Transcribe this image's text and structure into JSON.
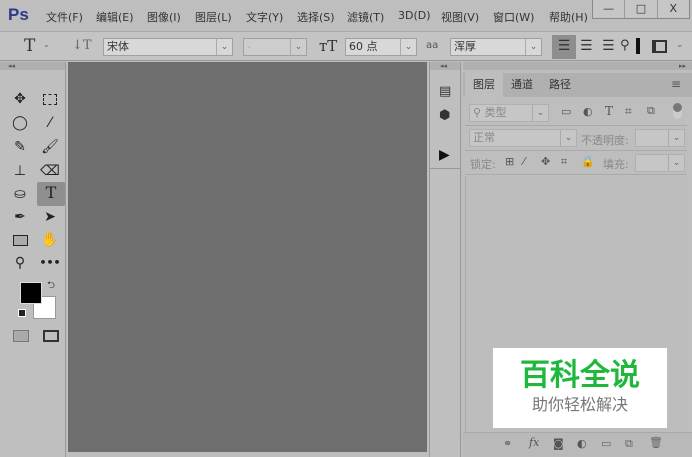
{
  "app": {
    "logo": "Ps"
  },
  "menu": [
    "文件(F)",
    "编辑(E)",
    "图像(I)",
    "图层(L)",
    "文字(Y)",
    "选择(S)",
    "滤镜(T)",
    "3D(D)",
    "视图(V)",
    "窗口(W)",
    "帮助(H)"
  ],
  "window_buttons": {
    "minimize": "—",
    "maximize": "□",
    "close": "X"
  },
  "options": {
    "tool_glyph": "T",
    "font_family": "宋体",
    "font_style": "-",
    "font_size": "60 点",
    "antialias_label": "aa",
    "antialias": "浑厚"
  },
  "tools": {
    "panel_collapse": "◂◂",
    "text_tool": "T",
    "more": "•••"
  },
  "colors": {
    "foreground": "#000000",
    "background": "#ffffff",
    "accent": "#2b3a8a",
    "watermark_green": "#1fb83c"
  },
  "mini_panel": {
    "collapse": "◂◂",
    "expand": "▸▸",
    "play": "▶"
  },
  "layers": {
    "tabs": [
      "图层",
      "通道",
      "路径"
    ],
    "filter_placeholder": "类型",
    "filter_T": "T",
    "blend_mode": "正常",
    "opacity_label": "不透明度:",
    "lock_label": "锁定:",
    "fill_label": "填充:",
    "footer": {
      "fx": "fx"
    }
  },
  "watermark": {
    "title": "百科全说",
    "subtitle": "助你轻松解决"
  }
}
